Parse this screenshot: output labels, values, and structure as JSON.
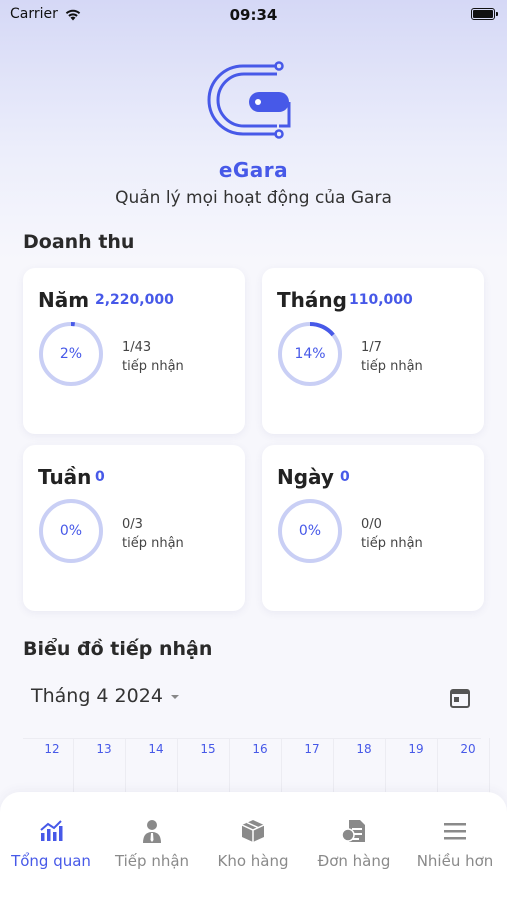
{
  "status_bar": {
    "carrier": "Carrier",
    "time": "09:34"
  },
  "header": {
    "app_name": "eGara",
    "tagline": "Quản lý mọi hoạt động của Gara"
  },
  "revenue": {
    "title": "Doanh thu",
    "cards": [
      {
        "period": "Năm",
        "value": "2,220,000",
        "percent_label": "2%",
        "progress": 0.02,
        "count": "1/43",
        "unit": "tiếp nhận"
      },
      {
        "period": "Tháng",
        "value": "110,000",
        "percent_label": "14%",
        "progress": 0.14,
        "count": "1/7",
        "unit": "tiếp nhận"
      },
      {
        "period": "Tuần",
        "value": "0",
        "percent_label": "0%",
        "progress": 0,
        "count": "0/3",
        "unit": "tiếp nhận"
      },
      {
        "period": "Ngày",
        "value": "0",
        "percent_label": "0%",
        "progress": 0,
        "count": "0/0",
        "unit": "tiếp nhận"
      }
    ]
  },
  "chart_section": {
    "title": "Biểu đồ tiếp nhận",
    "month": "Tháng 4 2024",
    "calendar_icon": "calendar-icon"
  },
  "chart_data": {
    "type": "bar",
    "categories": [
      "12",
      "13",
      "14",
      "15",
      "16",
      "17",
      "18",
      "19",
      "20"
    ],
    "values": []
  },
  "tabs": [
    {
      "label": "Tổng quan",
      "icon": "chart-icon",
      "active": true
    },
    {
      "label": "Tiếp nhận",
      "icon": "person-icon",
      "active": false
    },
    {
      "label": "Kho hàng",
      "icon": "box-icon",
      "active": false
    },
    {
      "label": "Đơn hàng",
      "icon": "invoice-icon",
      "active": false
    },
    {
      "label": "Nhiều hơn",
      "icon": "menu-icon",
      "active": false
    }
  ],
  "colors": {
    "accent": "#4759e8",
    "ring_track": "#c9cff5",
    "inactive": "#8a8a8a"
  }
}
